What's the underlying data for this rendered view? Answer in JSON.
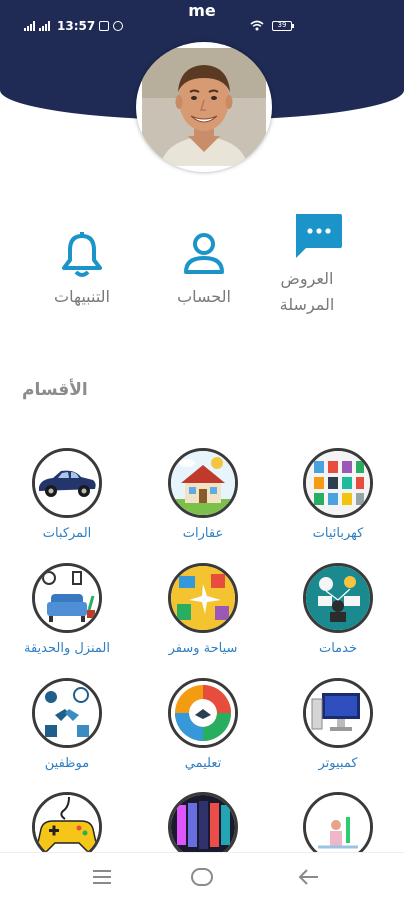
{
  "status_bar": {
    "time": "13:57",
    "battery": "39"
  },
  "header": {
    "title": "me"
  },
  "quick_actions": {
    "offers_label": "العروض المرسلة",
    "account_label": "الحساب",
    "alerts_label": "التنبيهات"
  },
  "categories_title": "الأقسام",
  "categories": [
    {
      "label": "كهربائيات"
    },
    {
      "label": "عقارات"
    },
    {
      "label": "المركبات"
    },
    {
      "label": "خدمات"
    },
    {
      "label": "سياحة وسفر"
    },
    {
      "label": "المنزل والحديقة"
    },
    {
      "label": "كمبيوتر"
    },
    {
      "label": "تعليمي"
    },
    {
      "label": "موظفين"
    },
    {
      "label": ""
    },
    {
      "label": ""
    },
    {
      "label": ""
    }
  ],
  "colors": {
    "header": "#1f2b55",
    "accent": "#1b95c9",
    "category_label": "#2f7fc3"
  }
}
